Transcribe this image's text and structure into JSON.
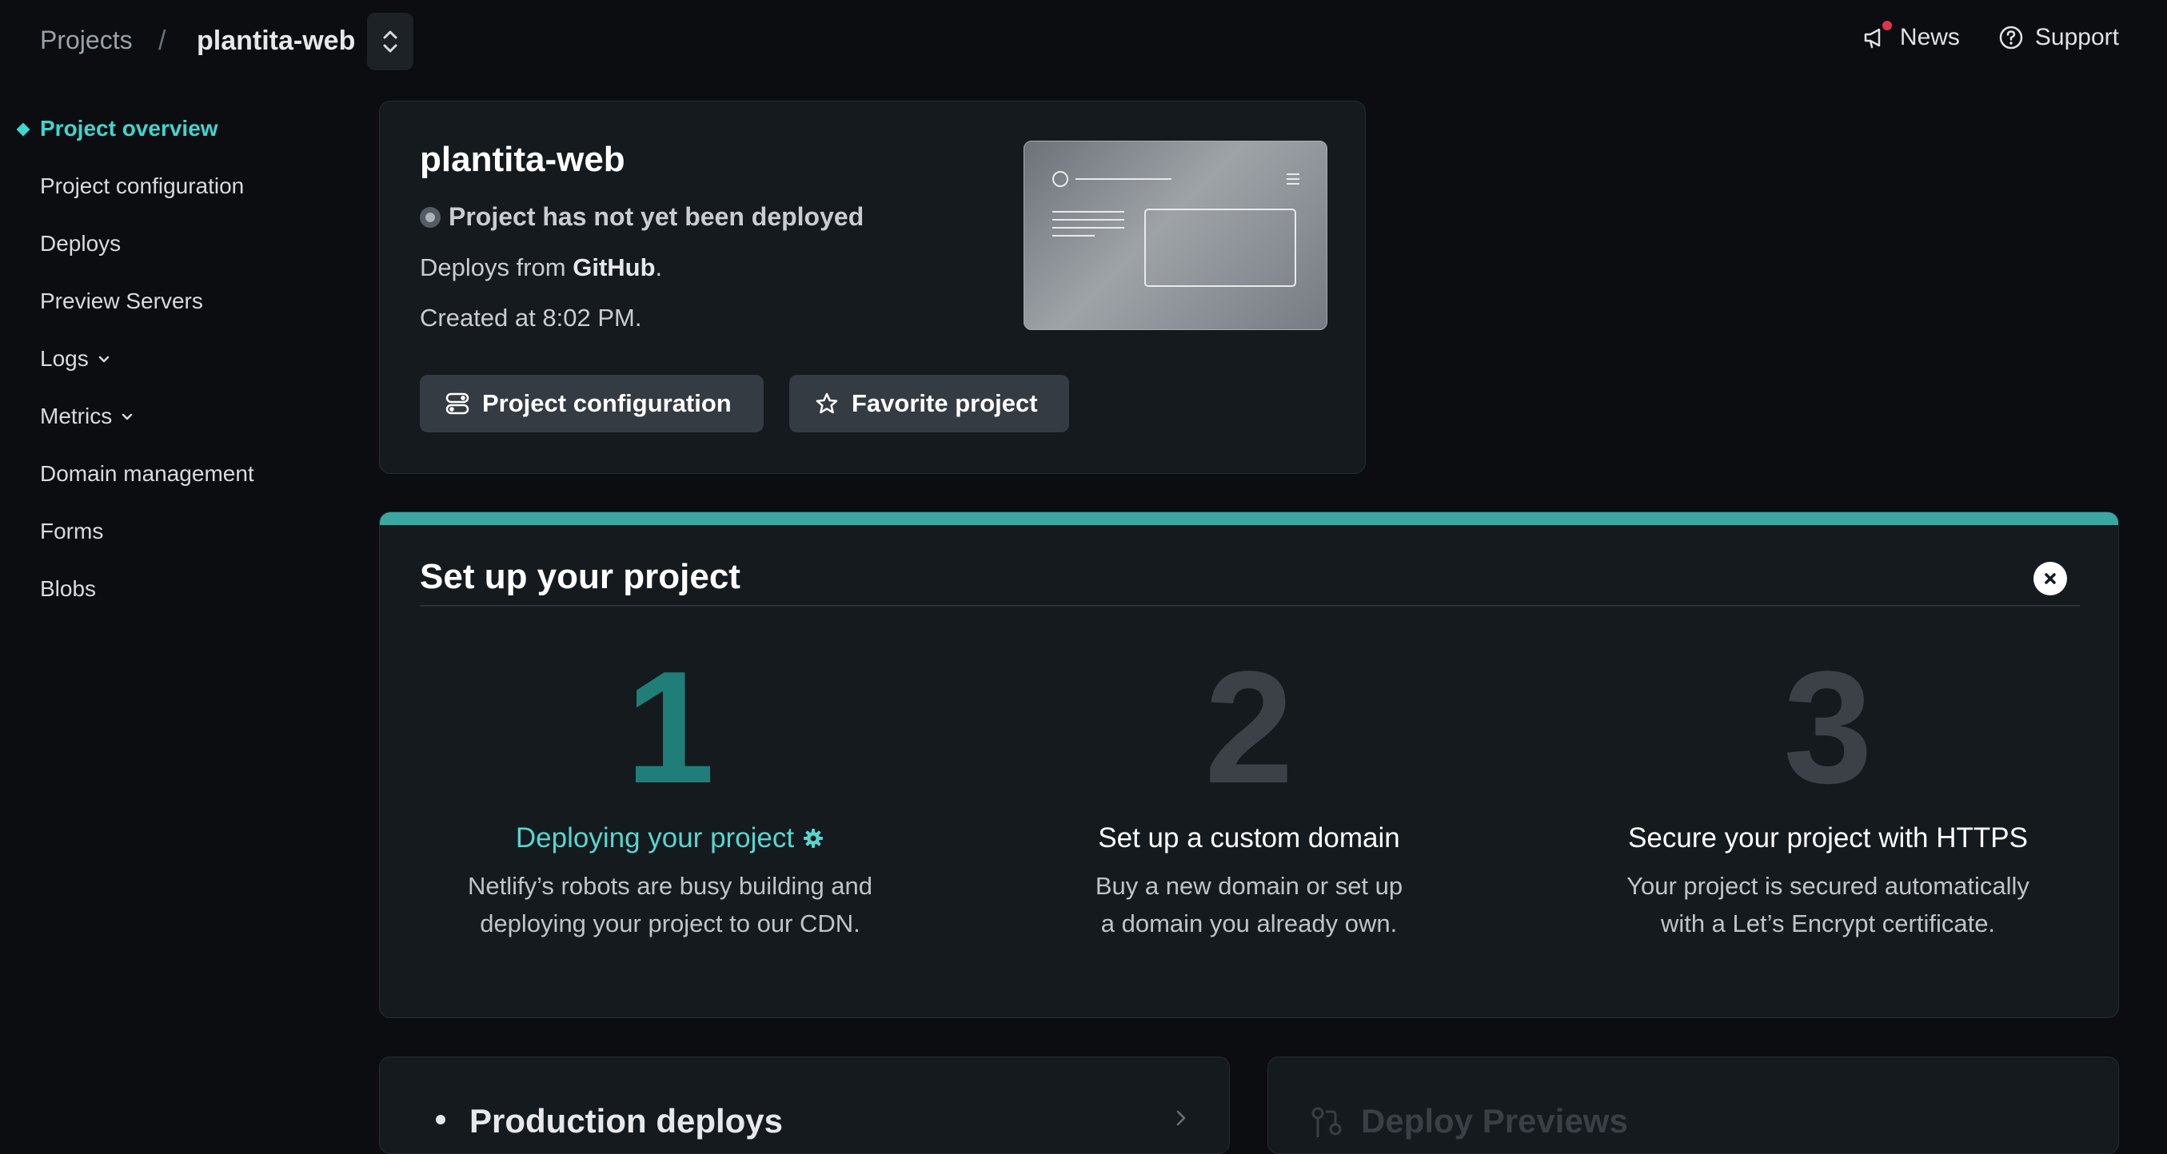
{
  "breadcrumb": {
    "projects": "Projects",
    "separator": "/",
    "current": "plantita-web"
  },
  "top_links": {
    "news": "News",
    "support": "Support"
  },
  "sidebar": {
    "items": [
      {
        "label": "Project overview",
        "active": true
      },
      {
        "label": "Project configuration"
      },
      {
        "label": "Deploys"
      },
      {
        "label": "Preview Servers"
      },
      {
        "label": "Logs",
        "expandable": true
      },
      {
        "label": "Metrics",
        "expandable": true
      },
      {
        "label": "Domain management"
      },
      {
        "label": "Forms"
      },
      {
        "label": "Blobs"
      }
    ]
  },
  "overview": {
    "title": "plantita-web",
    "status": "Project has not yet been deployed",
    "deploys_from_prefix": "Deploys from ",
    "deploys_from_source": "GitHub",
    "deploys_from_suffix": ".",
    "created": "Created at 8:02 PM.",
    "buttons": {
      "config": "Project configuration",
      "favorite": "Favorite project"
    }
  },
  "setup": {
    "title": "Set up your project",
    "steps": [
      {
        "number": "1",
        "title": "Deploying your project",
        "desc_line1": "Netlify’s robots are busy building and",
        "desc_line2": "deploying your project to our CDN.",
        "active": true
      },
      {
        "number": "2",
        "title": "Set up a custom domain",
        "desc_line1": "Buy a new domain or set up",
        "desc_line2": "a domain you already own."
      },
      {
        "number": "3",
        "title": "Secure your project with HTTPS",
        "desc_line1": "Your project is secured automatically",
        "desc_line2": "with a Let’s Encrypt certificate."
      }
    ]
  },
  "bottom_cards": {
    "production": "Production deploys",
    "previews": "Deploy Previews"
  },
  "colors": {
    "accent": "#3fd6cf",
    "accent_dark": "#1f7f78",
    "background": "#0b0d10",
    "card": "#151a1f",
    "button": "#353b42",
    "news_badge": "#e0334b"
  },
  "icons": [
    "chevron-up-down-icon",
    "megaphone-icon",
    "question-circle-icon",
    "toggle-icon",
    "star-icon",
    "gear-icon",
    "close-icon",
    "chevron-down-icon",
    "arrow-right-icon",
    "pull-request-icon"
  ]
}
